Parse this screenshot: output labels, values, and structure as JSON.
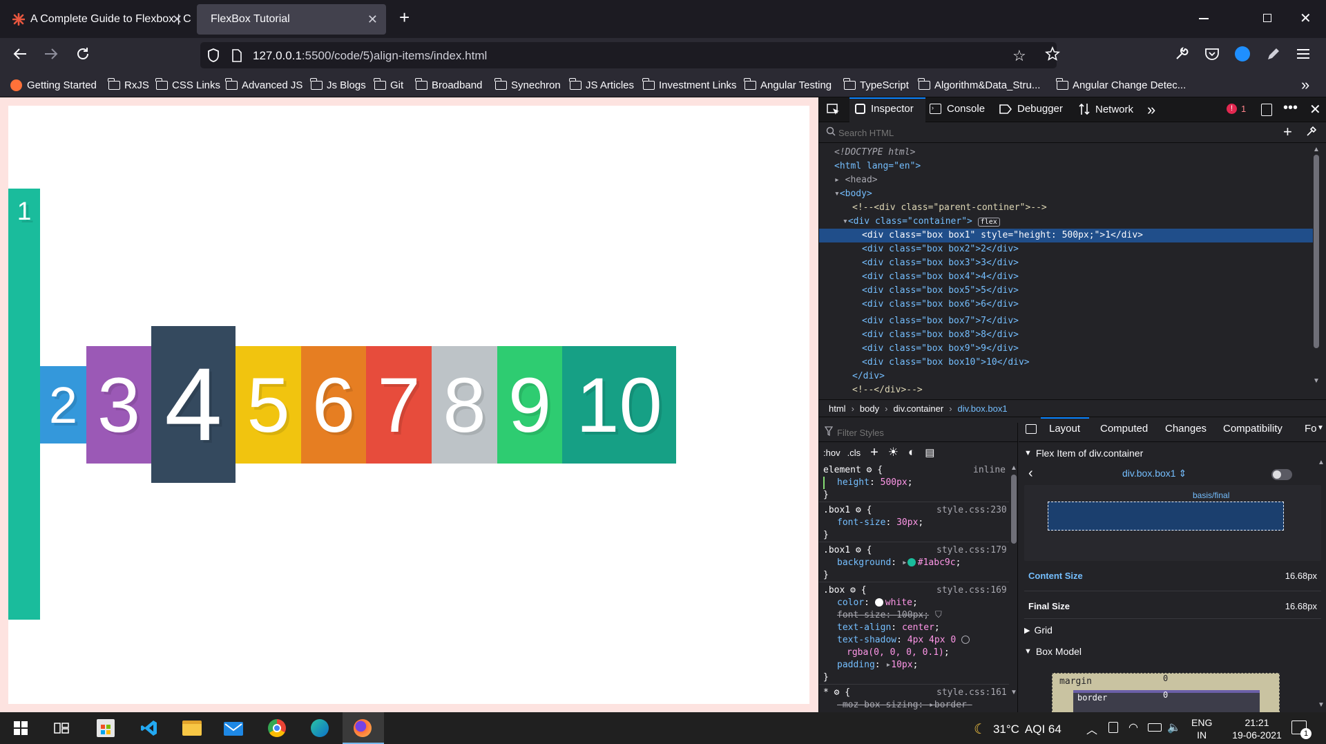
{
  "browser": {
    "tabs": [
      {
        "title": "A Complete Guide to Flexbox | C",
        "active": false
      },
      {
        "title": "FlexBox Tutorial",
        "active": true
      }
    ],
    "url_host": "127.0.0.1",
    "url_path": ":5500/code/5)align-items/index.html",
    "bookmarks": [
      "Getting Started",
      "RxJS",
      "CSS Links",
      "Advanced JS",
      "Js Blogs",
      "Git",
      "Broadband",
      "Synechron",
      "JS Articles",
      "Investment Links",
      "Angular Testing",
      "TypeScript",
      "Algorithm&Data_Stru...",
      "Angular Change Detec..."
    ]
  },
  "page": {
    "boxes": [
      {
        "label": "1",
        "color": "#1abc9c"
      },
      {
        "label": "2",
        "color": "#3498db"
      },
      {
        "label": "3",
        "color": "#9b59b6"
      },
      {
        "label": "4",
        "color": "#34495e"
      },
      {
        "label": "5",
        "color": "#f1c40f"
      },
      {
        "label": "6",
        "color": "#e67e22"
      },
      {
        "label": "7",
        "color": "#e74c3c"
      },
      {
        "label": "8",
        "color": "#bdc3c7"
      },
      {
        "label": "9",
        "color": "#2ecc71"
      },
      {
        "label": "10",
        "color": "#16a085"
      }
    ]
  },
  "devtools": {
    "tabs": [
      "Inspector",
      "Console",
      "Debugger",
      "Network"
    ],
    "error_count": "1",
    "search_placeholder": "Search HTML",
    "html_lines": [
      "<!DOCTYPE html>",
      "<html lang=\"en\">",
      "<head>",
      "<body>",
      "<!--<div class=\"parent-continer\">-->",
      "<div class=\"container\">",
      "<div class=\"box box1\" style=\"height: 500px;\">1</div>",
      "<div class=\"box box2\">2</div>",
      "<div class=\"box box3\">3</div>",
      "<div class=\"box box4\">4</div>",
      "<div class=\"box box5\">5</div>",
      "<div class=\"box box6\">6</div>",
      "<div class=\"box box7\">7</div>",
      "<div class=\"box box8\">8</div>",
      "<div class=\"box box9\">9</div>",
      "<div class=\"box box10\">10</div>",
      "</div>",
      "<!--</div>-->"
    ],
    "flex_badge": "flex",
    "breadcrumb": [
      "html",
      "body",
      "div.container",
      "div.box.box1"
    ],
    "filter_placeholder": "Filter Styles",
    "hov": ":hov",
    "cls": ".cls",
    "rules": [
      {
        "selector": "element",
        "source": "inline",
        "decls": [
          {
            "p": "height",
            "v": "500px"
          }
        ]
      },
      {
        "selector": ".box1",
        "source": "style.css:230",
        "decls": [
          {
            "p": "font-size",
            "v": "30px"
          }
        ]
      },
      {
        "selector": ".box1",
        "source": "style.css:179",
        "decls": [
          {
            "p": "background",
            "v": "#1abc9c"
          }
        ]
      },
      {
        "selector": ".box",
        "source": "style.css:169",
        "decls": [
          {
            "p": "color",
            "v": "white"
          },
          {
            "p": "font-size",
            "v": "100px",
            "struck": true
          },
          {
            "p": "text-align",
            "v": "center"
          },
          {
            "p": "text-shadow",
            "v": "4px 4px 0"
          },
          {
            "p": "",
            "v": "rgba(0, 0, 0, 0.1)"
          },
          {
            "p": "padding",
            "v": "10px"
          }
        ]
      },
      {
        "selector": "*",
        "source": "style.css:161",
        "decls": [
          {
            "p": "-moz-box-sizing",
            "v": "border-"
          }
        ]
      }
    ],
    "layout_tabs": [
      "Layout",
      "Computed",
      "Changes",
      "Compatibility",
      "Fo"
    ],
    "flex_item_title": "Flex Item of div.container",
    "flex_item_selector": "div.box.box1",
    "basis_label": "basis/final",
    "content_size_label": "Content Size",
    "content_size_value": "16.68px",
    "final_size_label": "Final Size",
    "final_size_value": "16.68px",
    "grid_label": "Grid",
    "box_model_label": "Box Model",
    "margin_label": "margin",
    "border_label": "border",
    "margin_value": "0",
    "border_value": "0"
  },
  "taskbar": {
    "weather": "31°C",
    "aqi": "AQI 64",
    "lang_top": "ENG",
    "lang_bottom": "IN",
    "time": "21:21",
    "date": "19-06-2021",
    "notification_count": "1"
  }
}
